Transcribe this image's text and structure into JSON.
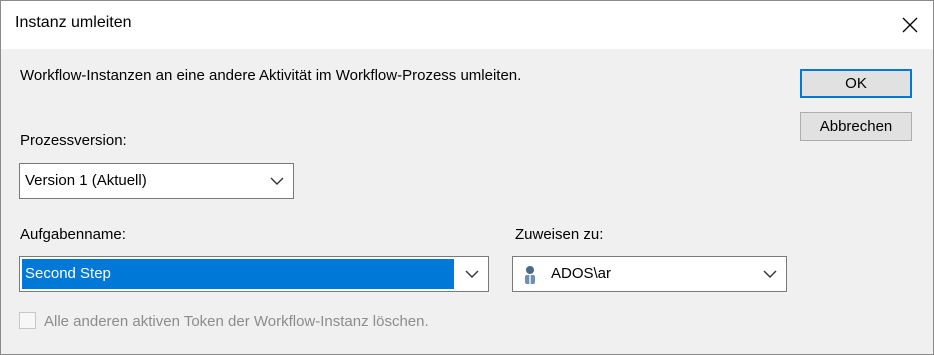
{
  "window": {
    "title": "Instanz umleiten",
    "close_icon": "close-icon"
  },
  "description": "Workflow-Instanzen an eine andere Aktivität im Workflow-Prozess umleiten.",
  "buttons": {
    "ok_label": "OK",
    "cancel_label": "Abbrechen"
  },
  "process_version": {
    "label": "Prozessversion:",
    "value": "Version 1 (Aktuell)"
  },
  "task_name": {
    "label": "Aufgabenname:",
    "value": "Second Step"
  },
  "assign_to": {
    "label": "Zuweisen zu:",
    "value": "ADOS\\ar",
    "icon": "user-icon"
  },
  "delete_tokens": {
    "label": "Alle anderen aktiven Token der Workflow-Instanz löschen.",
    "checked": false,
    "enabled": false
  },
  "colors": {
    "selection": "#0078d7",
    "dialog_bg": "#f0f0f0",
    "disabled_text": "#8c8c8c"
  }
}
